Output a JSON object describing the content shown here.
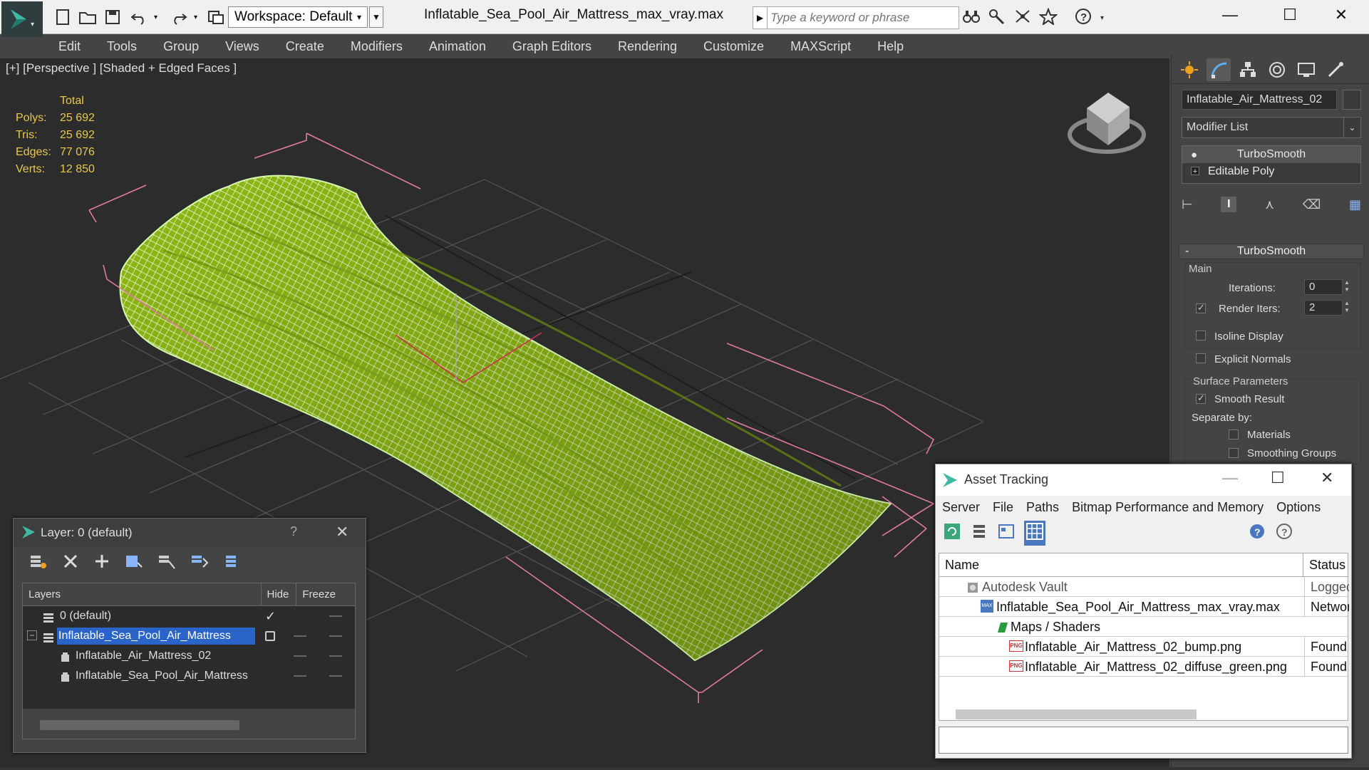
{
  "titlebar": {
    "workspace_label": "Workspace: Default",
    "document_title": "Inflatable_Sea_Pool_Air_Mattress_max_vray.max",
    "search_placeholder": "Type a keyword or phrase",
    "minimize": "—",
    "maximize": "☐",
    "close": "✕"
  },
  "menu": [
    "Edit",
    "Tools",
    "Group",
    "Views",
    "Create",
    "Modifiers",
    "Animation",
    "Graph Editors",
    "Rendering",
    "Customize",
    "MAXScript",
    "Help"
  ],
  "viewport": {
    "label": "[+] [Perspective ] [Shaded + Edged Faces ]",
    "stats_header": "Total",
    "stats": [
      {
        "key": "Polys:",
        "value": "25 692"
      },
      {
        "key": "Tris:",
        "value": "25 692"
      },
      {
        "key": "Edges:",
        "value": "77 076"
      },
      {
        "key": "Verts:",
        "value": "12 850"
      }
    ],
    "mesh_color": "#9ac417",
    "bbox_color": "#e07aa0"
  },
  "command_panel": {
    "object_name": "Inflatable_Air_Mattress_02",
    "modifier_list": "Modifier List",
    "stack": [
      "TurboSmooth",
      "Editable Poly"
    ],
    "rollout_title": "TurboSmooth",
    "rollout_collapse": "-",
    "main_label": "Main",
    "iterations_label": "Iterations:",
    "iterations_value": "0",
    "render_iters_label": "Render Iters:",
    "render_iters_value": "2",
    "isoline_label": "Isoline Display",
    "explicit_normals_label": "Explicit Normals",
    "surface_params_label": "Surface Parameters",
    "smooth_result_label": "Smooth Result",
    "separate_by_label": "Separate by:",
    "materials_label": "Materials",
    "smoothing_groups_label": "Smoothing Groups"
  },
  "layer_window": {
    "title": "Layer: 0 (default)",
    "help": "?",
    "close": "✕",
    "columns": [
      "Layers",
      "Hide",
      "Freeze"
    ],
    "rows": [
      {
        "name": "0 (default)",
        "indent": 0
      },
      {
        "name": "Inflatable_Sea_Pool_Air_Mattress",
        "indent": 0
      },
      {
        "name": "Inflatable_Air_Mattress_02",
        "indent": 1
      },
      {
        "name": "Inflatable_Sea_Pool_Air_Mattress",
        "indent": 1
      }
    ]
  },
  "asset_tracking": {
    "title": "Asset Tracking",
    "minimize": "—",
    "maximize": "☐",
    "close": "✕",
    "menu": [
      "Server",
      "File",
      "Paths",
      "Bitmap Performance and Memory",
      "Options"
    ],
    "columns": [
      "Name",
      "Status"
    ],
    "rows": [
      {
        "name": "Autodesk Vault",
        "status": "Logged Out"
      },
      {
        "name": "Inflatable_Sea_Pool_Air_Mattress_max_vray.max",
        "status": "Network"
      },
      {
        "name": "Maps / Shaders",
        "status": ""
      },
      {
        "name": "Inflatable_Air_Mattress_02_bump.png",
        "status": "Found"
      },
      {
        "name": "Inflatable_Air_Mattress_02_diffuse_green.png",
        "status": "Found"
      }
    ],
    "png_badge": "PNG",
    "max_badge": "MAX"
  }
}
